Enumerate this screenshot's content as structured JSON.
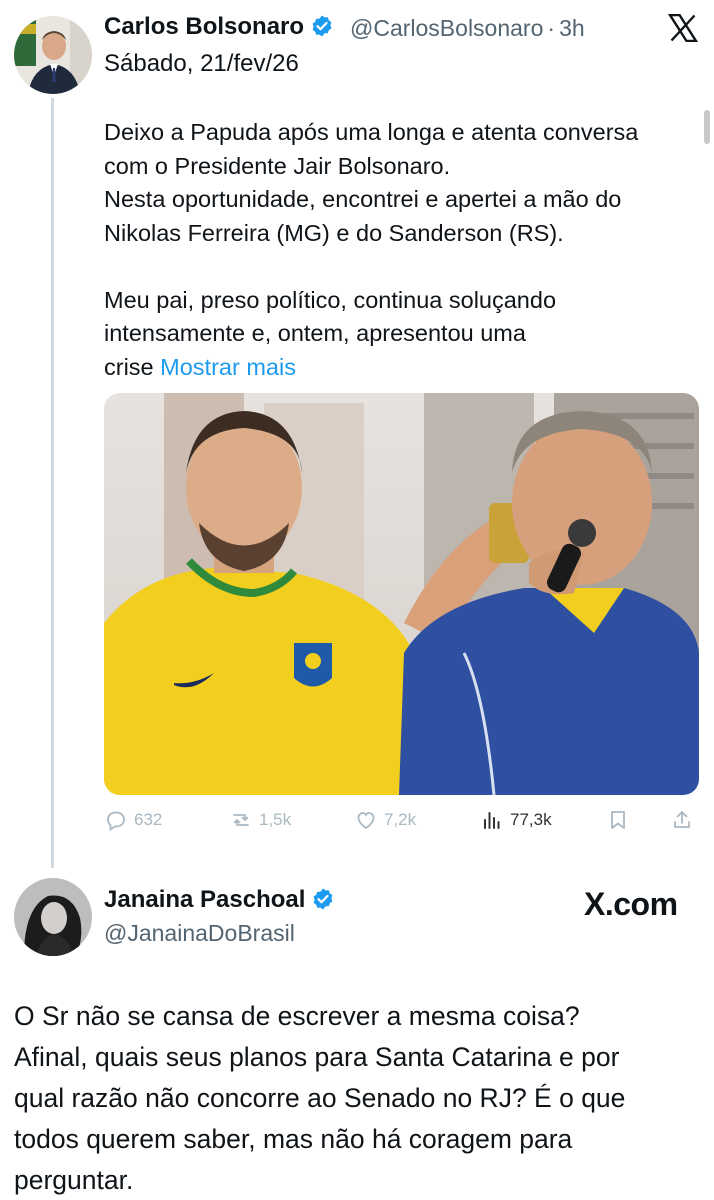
{
  "post": {
    "author_name": "Carlos Bolsonaro",
    "author_handle": "@CarlosBolsonaro",
    "separator": "·",
    "time": "3h",
    "date_line": "Sábado, 21/fev/26",
    "text_lines": [
      "Deixo a Papuda após uma longa e atenta conversa",
      "com o Presidente Jair Bolsonaro.",
      "Nesta oportunidade, encontrei e apertei a mão do",
      "Nikolas Ferreira (MG) e do Sanderson (RS).",
      "Meu pai, preso político, continua soluçando",
      "intensamente e, ontem, apresentou uma",
      "crise"
    ],
    "show_more": "Mostrar mais",
    "actions": {
      "replies": "632",
      "reposts": "1,5k",
      "likes": "7,2k",
      "views": "77,3k"
    }
  },
  "reply": {
    "author_name": "Janaina Paschoal",
    "author_handle": "@JanainaDoBrasil",
    "watermark": "X.com",
    "text_lines": [
      "O Sr não se cansa de escrever a mesma coisa?",
      "Afinal, quais seus planos para Santa Catarina e por",
      "qual razão não concorre ao Senado no RJ? É o que",
      "todos querem saber, mas não há coragem para",
      "perguntar."
    ]
  },
  "colors": {
    "text": "#0f1419",
    "secondary": "#536471",
    "link": "#1d9bf0",
    "verified": "#1d9bf0",
    "muted_icons": "#aab8c2"
  },
  "icons": [
    "x-logo-icon",
    "verified-badge-icon",
    "reply-icon",
    "repost-icon",
    "like-icon",
    "views-icon",
    "bookmark-icon",
    "share-icon"
  ]
}
